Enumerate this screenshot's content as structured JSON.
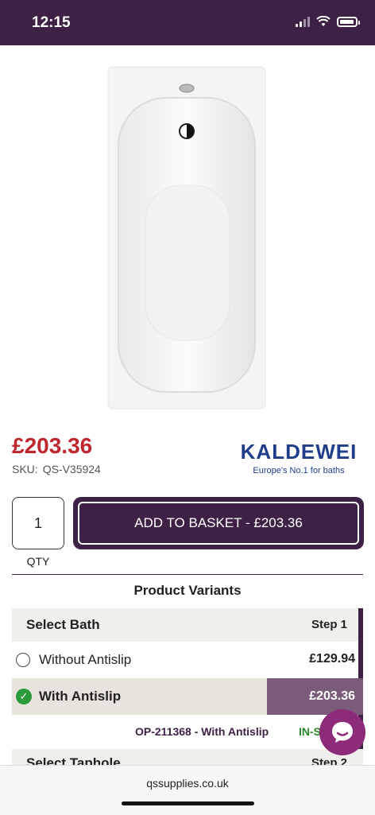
{
  "status_bar": {
    "time": "12:15"
  },
  "product": {
    "price": "£203.36",
    "sku_label": "SKU:",
    "sku_value": "QS-V35924"
  },
  "brand": {
    "name": "KALDEWEI",
    "tagline": "Europe's No.1 for baths"
  },
  "purchase": {
    "qty_value": "1",
    "qty_label": "QTY",
    "add_button_label": "ADD TO BASKET - £203.36"
  },
  "variants": {
    "title": "Product Variants",
    "step1": {
      "title": "Select Bath",
      "step_label": "Step 1",
      "options": [
        {
          "label": "Without Antislip",
          "price": "£129.94",
          "selected": false
        },
        {
          "label": "With Antislip",
          "price": "£203.36",
          "selected": true
        }
      ],
      "selected_code": "OP-211368 - With Antislip",
      "stock_status": "IN-S"
    },
    "step2": {
      "title": "Select Taphole",
      "step_label": "Step 2"
    }
  },
  "browser": {
    "url": "qssupplies.co.uk"
  },
  "colors": {
    "brand_purple": "#3e2246",
    "price_red": "#c0262d",
    "in_stock_green": "#2a8a2a",
    "chat_bubble": "#8b2b7a"
  }
}
